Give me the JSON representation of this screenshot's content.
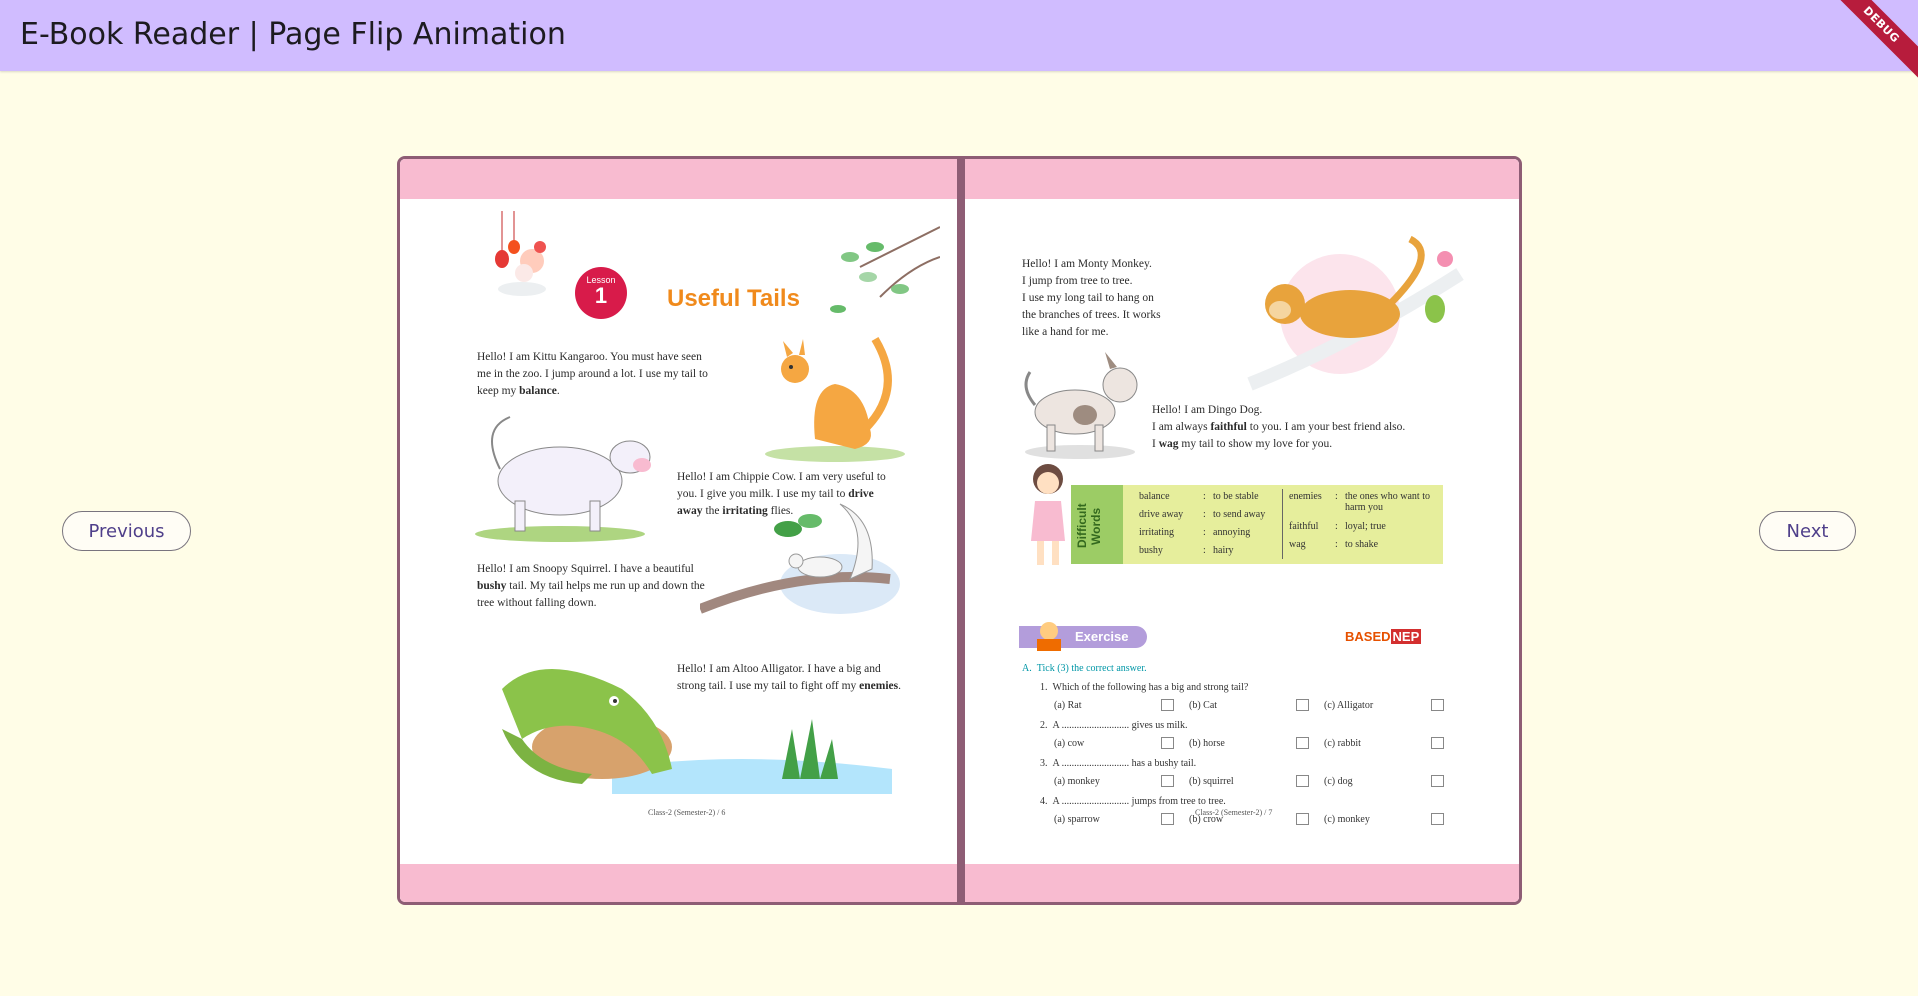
{
  "app": {
    "title": "E-Book Reader | Page Flip Animation",
    "debug_label": "DEBUG"
  },
  "nav": {
    "previous_label": "Previous",
    "next_label": "Next"
  },
  "colors": {
    "appbar": "#d0bcff",
    "background": "#fffde7",
    "book_border": "#8e5d75",
    "page_band": "#f8bbd0",
    "lesson_title": "#f08a1c",
    "lesson_badge": "#d81b4a"
  },
  "left_page": {
    "lesson_word": "Lesson",
    "lesson_number": "1",
    "lesson_title": "Useful Tails",
    "kangaroo": {
      "text_before": "Hello! I am Kittu Kangaroo. You must have seen me in the zoo. I jump around a lot. I use my tail to keep my",
      "bold": "balance",
      "text_after": "."
    },
    "cow": {
      "text_before": "Hello! I am Chippie Cow. I am very useful to you. I give you milk. I use my tail to",
      "bold1": "drive away",
      "text_mid": "the",
      "bold2": "irritating",
      "text_after": "flies."
    },
    "squirrel": {
      "text_before": "Hello! I am Snoopy Squirrel. I have a beautiful",
      "bold": "bushy",
      "text_after": "tail. My tail helps me run up and down the tree without falling down."
    },
    "alligator": {
      "text_before": "Hello! I am Altoo Alligator. I have a big and strong tail. I use my tail to fight off my",
      "bold": "enemies",
      "text_after": "."
    },
    "footer": "Class-2 (Semester-2) / 6"
  },
  "right_page": {
    "monkey": [
      "Hello! I am Monty Monkey.",
      "I jump from tree to tree.",
      "I use my long tail to hang on",
      "the branches of trees. It works",
      "like a hand for me."
    ],
    "dog": {
      "line1": "Hello! I am Dingo Dog.",
      "line2_before": "I am always",
      "line2_bold": "faithful",
      "line2_after": "to you. I am your best friend also.",
      "line3_before": "I",
      "line3_bold": "wag",
      "line3_after": "my tail to show my love for you."
    },
    "difficult_words": {
      "heading": "Difficult Words",
      "left": [
        {
          "word": "balance",
          "meaning": "to be stable"
        },
        {
          "word": "drive away",
          "meaning": "to send away"
        },
        {
          "word": "irritating",
          "meaning": "annoying"
        },
        {
          "word": "bushy",
          "meaning": "hairy"
        }
      ],
      "right": [
        {
          "word": "enemies",
          "meaning": "the ones who want to harm you"
        },
        {
          "word": "faithful",
          "meaning": "loyal; true"
        },
        {
          "word": "wag",
          "meaning": "to shake"
        }
      ]
    },
    "exercise_label": "Exercise",
    "nep_badge_prefix": "BASED",
    "nep_badge_nep": "NEP",
    "instruction_prefix": "A.",
    "instruction": "Tick (3) the correct answer.",
    "questions": [
      {
        "num": "1.",
        "text": "Which of the following has a big and strong tail?",
        "options": [
          "(a) Rat",
          "(b) Cat",
          "(c) Alligator"
        ]
      },
      {
        "num": "2.",
        "text": "A ........................... gives us milk.",
        "options": [
          "(a) cow",
          "(b) horse",
          "(c) rabbit"
        ]
      },
      {
        "num": "3.",
        "text": "A ........................... has a bushy tail.",
        "options": [
          "(a) monkey",
          "(b) squirrel",
          "(c) dog"
        ]
      },
      {
        "num": "4.",
        "text": "A ........................... jumps from tree to tree.",
        "options": [
          "(a) sparrow",
          "(b) crow",
          "(c) monkey"
        ]
      }
    ],
    "footer": "Class-2 (Semester-2) / 7"
  }
}
